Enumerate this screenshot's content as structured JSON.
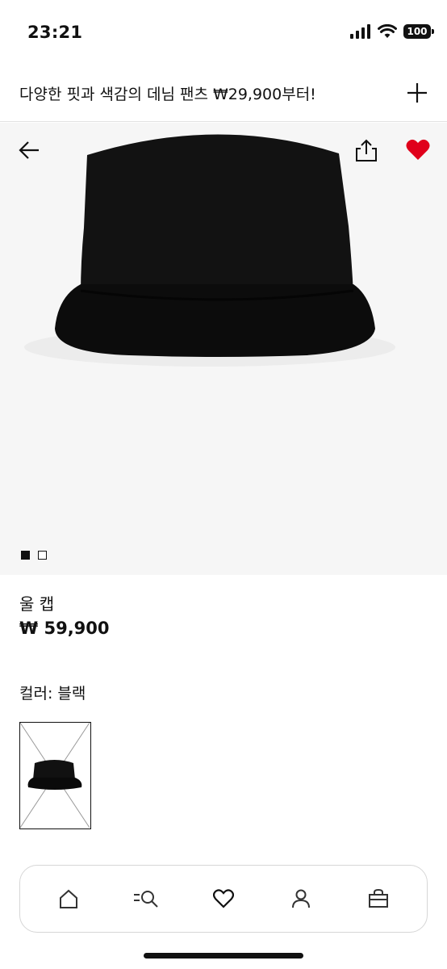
{
  "status_bar": {
    "time": "23:21",
    "battery": "100",
    "icons": [
      "signal-icon",
      "wifi-icon",
      "battery-icon"
    ]
  },
  "promo": {
    "text": "다양한 핏과 색감의 데님 팬츠 ₩29,900부터!",
    "action_icon": "plus-icon"
  },
  "product_image": {
    "top_icons": [
      "back-arrow-icon",
      "share-icon",
      "heart-filled-icon"
    ],
    "dots": [
      true,
      false
    ],
    "accent_color": "#e0001b"
  },
  "product": {
    "name": "울 캡",
    "price": "₩ 59,900",
    "color_label": "컬러: 블랙"
  },
  "bottom_nav": {
    "items": [
      "home-icon",
      "search-icon",
      "heart-icon",
      "user-icon",
      "bag-icon"
    ]
  }
}
